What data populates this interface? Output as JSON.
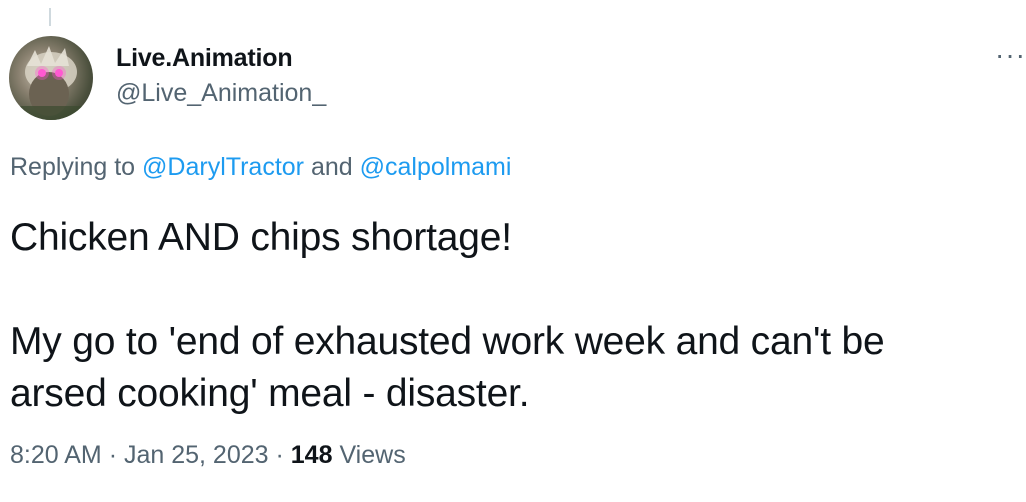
{
  "author": {
    "display_name": "Live.Animation",
    "handle": "@Live_Animation_",
    "avatar_icon": "avatar-glowing-eyes-creature"
  },
  "more_menu": {
    "label": "···",
    "icon": "more-horizontal-icon"
  },
  "reply_context": {
    "prefix": "Replying to",
    "mention_1": "@DarylTractor",
    "joiner": "and",
    "mention_2": "@calpolmami"
  },
  "tweet": {
    "line_1": "Chicken AND chips shortage!",
    "line_2": "My go to 'end of exhausted work week and can't be",
    "line_3": "arsed cooking' meal - disaster."
  },
  "meta": {
    "time": "8:20 AM",
    "separator": "·",
    "date": "Jan 25, 2023",
    "views_count": "148",
    "views_label": "Views"
  },
  "colors": {
    "text_primary": "#0f1419",
    "text_secondary": "#536471",
    "link": "#1d9bf0"
  }
}
